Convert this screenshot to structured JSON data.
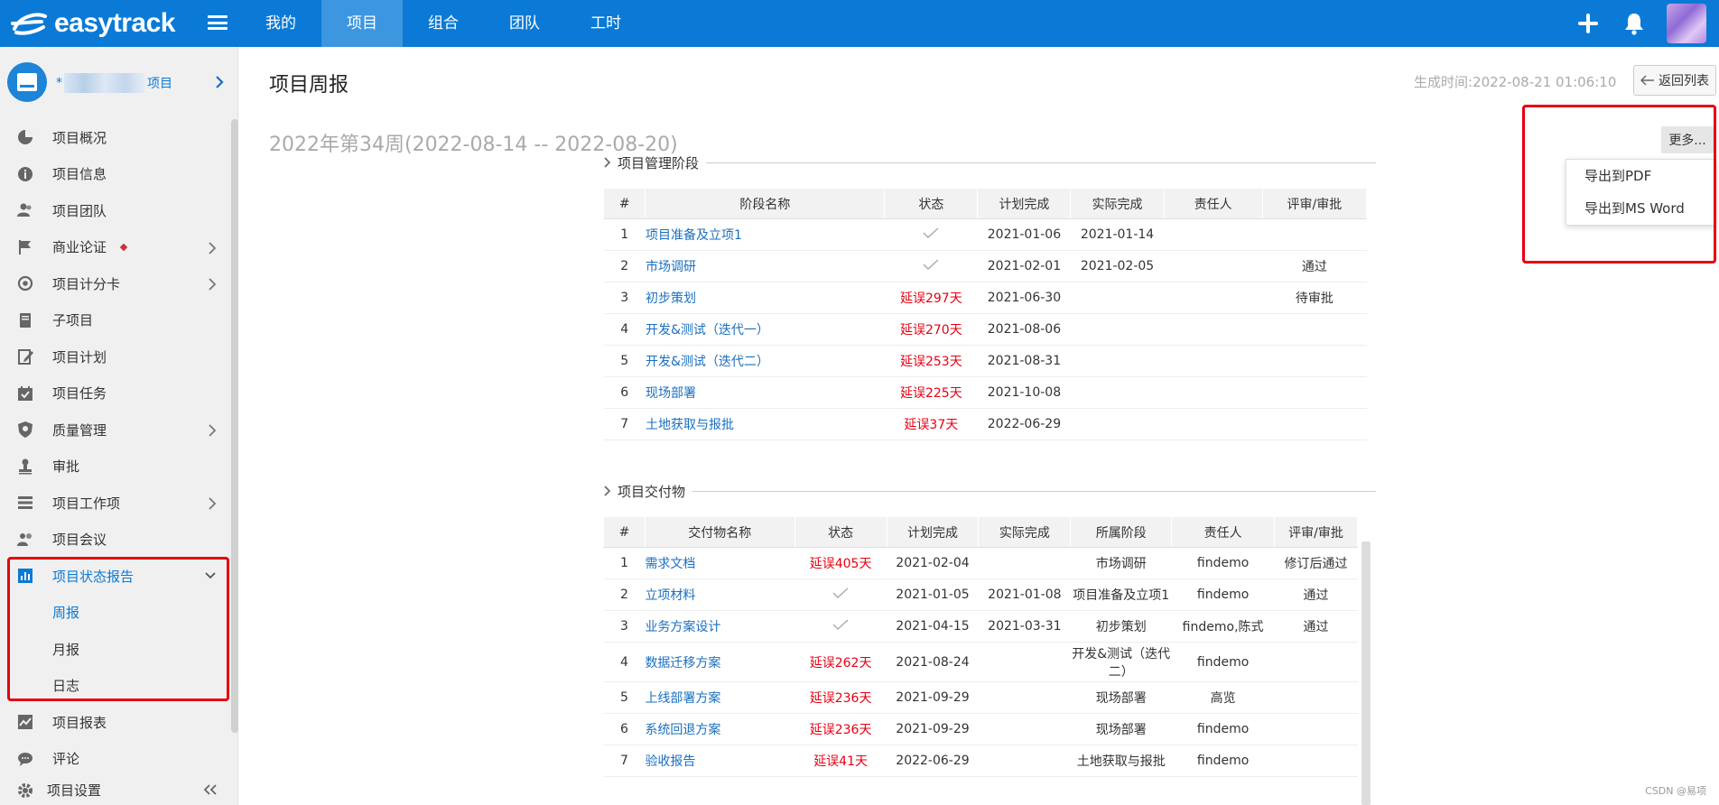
{
  "app": {
    "logo_text": "easytrack",
    "brand_color": "#0a7ad6"
  },
  "nav": {
    "items": [
      "我的",
      "项目",
      "组合",
      "团队",
      "工时"
    ],
    "active": "项目"
  },
  "project": {
    "name_prefix": "*",
    "name_suffix": "项目"
  },
  "sidebar": {
    "items": [
      {
        "label": "项目概况",
        "icon": "pie-chart-icon"
      },
      {
        "label": "项目信息",
        "icon": "info-icon"
      },
      {
        "label": "项目团队",
        "icon": "team-icon"
      },
      {
        "label": "商业论证",
        "icon": "flag-icon",
        "has_children": true,
        "badge": true
      },
      {
        "label": "项目计分卡",
        "icon": "target-icon",
        "has_children": true
      },
      {
        "label": "子项目",
        "icon": "document-icon"
      },
      {
        "label": "项目计划",
        "icon": "plan-edit-icon"
      },
      {
        "label": "项目任务",
        "icon": "calendar-check-icon"
      },
      {
        "label": "质量管理",
        "icon": "shield-icon",
        "has_children": true
      },
      {
        "label": "审批",
        "icon": "stamp-icon"
      },
      {
        "label": "项目工作项",
        "icon": "list-icon",
        "has_children": true
      },
      {
        "label": "项目会议",
        "icon": "meeting-icon"
      },
      {
        "label": "项目状态报告",
        "icon": "bar-chart-icon",
        "expanded": true,
        "active": true
      },
      {
        "label": "周报",
        "sub": true,
        "active": true
      },
      {
        "label": "月报",
        "sub": true
      },
      {
        "label": "日志",
        "sub": true
      },
      {
        "label": "项目报表",
        "icon": "report-chart-icon"
      },
      {
        "label": "评论",
        "icon": "comment-icon"
      }
    ],
    "footer": {
      "label": "项目设置",
      "icon": "gear-icon"
    }
  },
  "header": {
    "title": "项目周报",
    "generated": "生成时间:2022-08-21 01:06:10",
    "back_label": "返回列表",
    "week": "2022年第34周(2022-08-14 -- 2022-08-20)",
    "more_label": "更多...",
    "export_options": [
      "导出到PDF",
      "导出到MS Word"
    ]
  },
  "phases": {
    "title": "项目管理阶段",
    "columns": [
      "#",
      "阶段名称",
      "状态",
      "计划完成",
      "实际完成",
      "责任人",
      "评审/审批"
    ],
    "rows": [
      {
        "no": "1",
        "name": "项目准备及立项1",
        "status": "",
        "done": true,
        "plan": "2021-01-06",
        "actual": "2021-01-14",
        "owner": "",
        "review": ""
      },
      {
        "no": "2",
        "name": "市场调研",
        "status": "",
        "done": true,
        "plan": "2021-02-01",
        "actual": "2021-02-05",
        "owner": "",
        "review": "通过"
      },
      {
        "no": "3",
        "name": "初步策划",
        "status": "延误297天",
        "done": false,
        "plan": "2021-06-30",
        "actual": "",
        "owner": "",
        "review": "待审批"
      },
      {
        "no": "4",
        "name": "开发&测试（迭代一）",
        "status": "延误270天",
        "done": false,
        "plan": "2021-08-06",
        "actual": "",
        "owner": "",
        "review": ""
      },
      {
        "no": "5",
        "name": "开发&测试（迭代二）",
        "status": "延误253天",
        "done": false,
        "plan": "2021-08-31",
        "actual": "",
        "owner": "",
        "review": ""
      },
      {
        "no": "6",
        "name": "现场部署",
        "status": "延误225天",
        "done": false,
        "plan": "2021-10-08",
        "actual": "",
        "owner": "",
        "review": ""
      },
      {
        "no": "7",
        "name": "土地获取与报批",
        "status": "延误37天",
        "done": false,
        "plan": "2022-06-29",
        "actual": "",
        "owner": "",
        "review": ""
      }
    ]
  },
  "deliverables": {
    "title": "项目交付物",
    "columns": [
      "#",
      "交付物名称",
      "状态",
      "计划完成",
      "实际完成",
      "所属阶段",
      "责任人",
      "评审/审批"
    ],
    "rows": [
      {
        "no": "1",
        "name": "需求文档",
        "status": "延误405天",
        "done": false,
        "plan": "2021-02-04",
        "actual": "",
        "phase": "市场调研",
        "owner": "findemo",
        "review": "修订后通过"
      },
      {
        "no": "2",
        "name": "立项材料",
        "status": "",
        "done": true,
        "plan": "2021-01-05",
        "actual": "2021-01-08",
        "phase": "项目准备及立项1",
        "owner": "findemo",
        "review": "通过"
      },
      {
        "no": "3",
        "name": "业务方案设计",
        "status": "",
        "done": true,
        "plan": "2021-04-15",
        "actual": "2021-03-31",
        "phase": "初步策划",
        "owner": "findemo,陈式",
        "review": "通过"
      },
      {
        "no": "4",
        "name": "数据迁移方案",
        "status": "延误262天",
        "done": false,
        "plan": "2021-08-24",
        "actual": "",
        "phase": "开发&测试（迭代二）",
        "owner": "findemo",
        "review": ""
      },
      {
        "no": "5",
        "name": "上线部署方案",
        "status": "延误236天",
        "done": false,
        "plan": "2021-09-29",
        "actual": "",
        "phase": "现场部署",
        "owner": "高览",
        "review": ""
      },
      {
        "no": "6",
        "name": "系统回退方案",
        "status": "延误236天",
        "done": false,
        "plan": "2021-09-29",
        "actual": "",
        "phase": "现场部署",
        "owner": "findemo",
        "review": ""
      },
      {
        "no": "7",
        "name": "验收报告",
        "status": "延误41天",
        "done": false,
        "plan": "2022-06-29",
        "actual": "",
        "phase": "土地获取与报批",
        "owner": "findemo",
        "review": ""
      }
    ]
  },
  "watermark": "CSDN @易项"
}
